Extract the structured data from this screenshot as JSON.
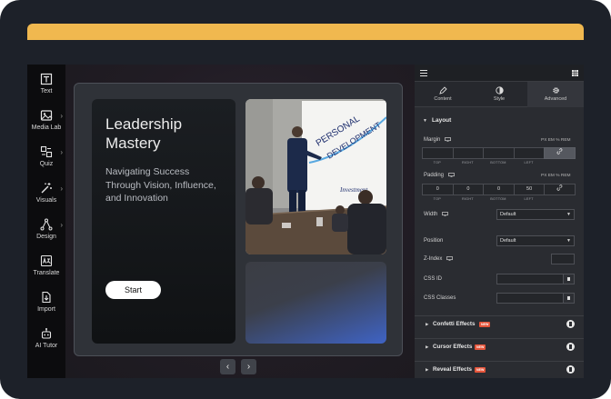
{
  "toolbar": {
    "items": [
      {
        "label": "Text",
        "icon": "text-icon",
        "chevron": false
      },
      {
        "label": "Media Lab",
        "icon": "image-icon",
        "chevron": true
      },
      {
        "label": "Quiz",
        "icon": "quiz-icon",
        "chevron": true
      },
      {
        "label": "Visuals",
        "icon": "magic-wand-icon",
        "chevron": true
      },
      {
        "label": "Design",
        "icon": "design-icon",
        "chevron": true
      },
      {
        "label": "Translate",
        "icon": "translate-icon",
        "chevron": false
      },
      {
        "label": "Import",
        "icon": "import-icon",
        "chevron": false
      },
      {
        "label": "AI Tutor",
        "icon": "ai-tutor-icon",
        "chevron": false
      }
    ]
  },
  "slide": {
    "title": "Leadership Mastery",
    "subtitle": "Navigating Success Through Vision, Influence, and Innovation",
    "start_label": "Start",
    "photo": {
      "board_text_1": "PERSONAL",
      "board_text_2": "DEVELOPMENT",
      "board_text_3": "Investment"
    }
  },
  "canvas_nav": {
    "prev": "‹",
    "next": "›"
  },
  "panel": {
    "tabs": [
      {
        "label": "Content",
        "icon": "pencil-icon"
      },
      {
        "label": "Style",
        "icon": "contrast-icon"
      },
      {
        "label": "Advanced",
        "icon": "gear-icon",
        "active": true
      }
    ],
    "layout": {
      "heading": "Layout",
      "margin": {
        "label": "Margin",
        "units": "PX  EM  %  REM",
        "values": [
          "",
          "",
          "",
          ""
        ],
        "captions": [
          "TOP",
          "RIGHT",
          "BOTTOM",
          "LEFT"
        ]
      },
      "padding": {
        "label": "Padding",
        "units": "PX  EM  %  REM",
        "values": [
          "0",
          "0",
          "0",
          "50"
        ],
        "captions": [
          "TOP",
          "RIGHT",
          "BOTTOM",
          "LEFT"
        ]
      },
      "width": {
        "label": "Width",
        "value": "Default"
      },
      "position": {
        "label": "Position",
        "value": "Default"
      },
      "zindex": {
        "label": "Z-Index"
      },
      "css_id": {
        "label": "CSS ID"
      },
      "css_classes": {
        "label": "CSS Classes"
      }
    },
    "collapsed_sections": [
      {
        "label": "Confetti Effects",
        "badge": "NEW"
      },
      {
        "label": "Cursor Effects",
        "badge": "NEW"
      },
      {
        "label": "Reveal Effects",
        "badge": "NEW"
      }
    ]
  },
  "colors": {
    "top_accent": "#f0b84f",
    "new_badge": "#e4543a",
    "gradient_blue": "#3f63c4"
  }
}
